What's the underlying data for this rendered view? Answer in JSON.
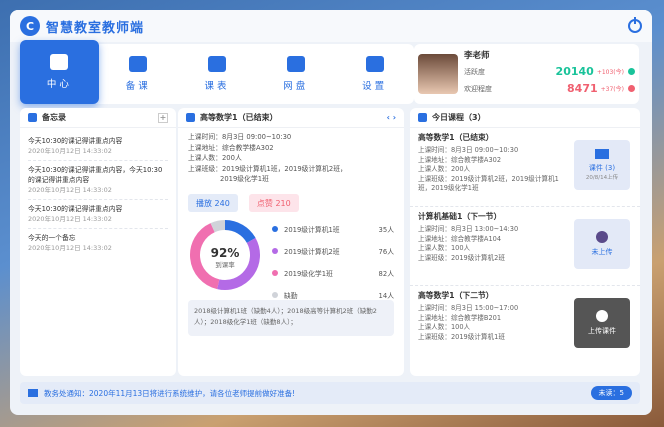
{
  "app": {
    "title": "智慧教室教师端"
  },
  "nav": [
    {
      "label": "中心",
      "icon": "grid-icon",
      "active": true
    },
    {
      "label": "备课",
      "icon": "book-icon"
    },
    {
      "label": "课表",
      "icon": "calendar-icon"
    },
    {
      "label": "网盘",
      "icon": "disk-icon"
    },
    {
      "label": "设置",
      "icon": "monitor-icon"
    }
  ],
  "profile": {
    "name": "李老师",
    "activity_label": "活跃度",
    "activity_value": "20140",
    "activity_delta": "+103(今)",
    "welcome_label": "欢迎程度",
    "welcome_value": "8471",
    "welcome_delta": "+37(今)"
  },
  "memo": {
    "title": "备忘录",
    "items": [
      {
        "text": "今天10:30的课记得讲重点内容",
        "time": "2020年10月12日 14:33:02"
      },
      {
        "text": "今天10:30的课记得讲重点内容，今天10:30的课记得讲重点内容",
        "time": "2020年10月12日 14:33:02"
      },
      {
        "text": "今天10:30的课记得讲重点内容",
        "time": "2020年10月12日 14:33:02"
      },
      {
        "text": "今天的一个备忘",
        "time": "2020年10月12日 14:33:02"
      }
    ]
  },
  "current": {
    "title": "高等数学1（已结束）",
    "lines": [
      "上课时间：8月3日 09:00~10:30",
      "上课地址：综合教学楼A302",
      "上课人数：200人",
      "上课班级：2019级计算机1班，2019级计算机2班，",
      "2019级化学1班"
    ],
    "play_label": "播放 240",
    "like_label": "点赞 210",
    "rate": "92%",
    "rate_label": "到课率",
    "legend": [
      {
        "name": "2019级计算机1班",
        "count": "35人",
        "color": "#2a6fe0"
      },
      {
        "name": "2019级计算机2班",
        "count": "76人",
        "color": "#b46ae6"
      },
      {
        "name": "2019级化学1班",
        "count": "82人",
        "color": "#f06fb0"
      },
      {
        "name": "缺勤",
        "count": "14人",
        "color": "#d0d3d9"
      }
    ],
    "note": "2018级计算机1班（缺勤4人）；2018级高等计算机2班（缺勤2人）；2018级化学1班（缺勤8人）；"
  },
  "chart_data": {
    "type": "pie",
    "categories": [
      "2019级计算机1班",
      "2019级计算机2班",
      "2019级化学1班",
      "缺勤"
    ],
    "values": [
      35,
      76,
      82,
      14
    ]
  },
  "today": {
    "title": "今日课程（3）",
    "courses": [
      {
        "title": "高等数学1（已结束）",
        "lines": [
          "上课时间：8月3日 09:00~10:30",
          "上课地址：综合教学楼A302",
          "上课人数：200人",
          "上课班级：2019级计算机2班，2019级计算机1班，2019级化学1班"
        ],
        "side_label": "课件 (3)",
        "side_sub": "20/8/14上传"
      },
      {
        "title": "计算机基础1（下一节）",
        "lines": [
          "上课时间：8月3日 13:00~14:30",
          "上课地址：综合教学楼A104",
          "上课人数：100人",
          "上课班级：2019级计算机2班"
        ],
        "side_label": "未上传",
        "side_sub": ""
      },
      {
        "title": "高等数学1（下二节）",
        "lines": [
          "上课时间：8月3日 15:00~17:00",
          "上课地址：综合教学楼B201",
          "上课人数：100人",
          "上课班级：2019级计算机1班"
        ],
        "side_label": "上传课件",
        "side_sub": ""
      }
    ]
  },
  "status": {
    "text": "教务处通知：2020年11月13日将进行系统维护，请各位老师提前做好准备!",
    "unread": "未读：5"
  }
}
